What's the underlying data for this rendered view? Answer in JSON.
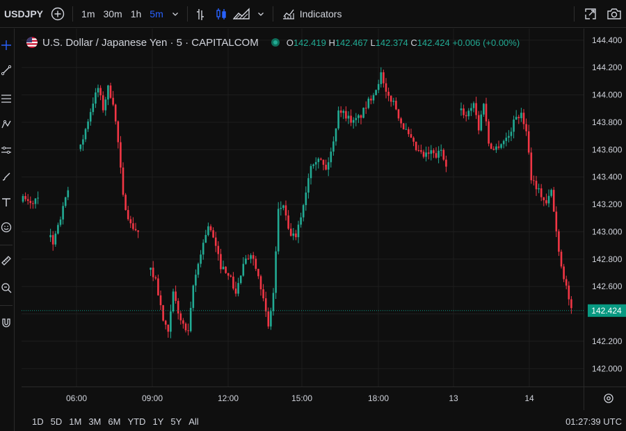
{
  "toolbar": {
    "symbol": "USDJPY",
    "intervals": [
      "1m",
      "30m",
      "1h",
      "5m"
    ],
    "active_interval": "5m",
    "indicators_label": "Indicators"
  },
  "legend": {
    "title": "U.S. Dollar / Japanese Yen · 5 · CAPITALCOM",
    "o_label": "O",
    "o_value": "142.419",
    "h_label": "H",
    "h_value": "142.467",
    "l_label": "L",
    "l_value": "142.374",
    "c_label": "C",
    "c_value": "142.424",
    "change": "+0.006 (+0.00%)"
  },
  "bottom": {
    "ranges": [
      "1D",
      "5D",
      "1M",
      "3M",
      "6M",
      "YTD",
      "1Y",
      "5Y",
      "All"
    ],
    "clock": "01:27:39 UTC"
  },
  "colors": {
    "up": "#22ab94",
    "down": "#f23645",
    "background": "#0f0f0f",
    "grid": "#1e1e1e",
    "accent": "#2962ff",
    "price_tag": "#089981"
  },
  "icons": [
    "plus-circle-icon",
    "chevron-down-icon",
    "bar-chart-icon",
    "candles-icon",
    "area-chart-icon",
    "indicators-icon",
    "fullscreen-icon",
    "camera-icon",
    "settings-icon"
  ],
  "chart_data": {
    "type": "candlestick",
    "symbol": "USDJPY",
    "interval": "5",
    "y_ticks": [
      "144.400",
      "144.200",
      "144.000",
      "143.800",
      "143.600",
      "143.400",
      "143.200",
      "143.000",
      "142.800",
      "142.600",
      "142.400",
      "142.200",
      "142.000"
    ],
    "ylim": [
      141.92,
      144.46
    ],
    "x_ticks": [
      "06:00",
      "09:00",
      "12:00",
      "15:00",
      "18:00",
      "13",
      "14"
    ],
    "last_price": "142.424",
    "path": [
      [
        0,
        143.24
      ],
      [
        3,
        143.2
      ],
      [
        6,
        143.25
      ],
      [
        10,
        143.05
      ],
      [
        12,
        142.9
      ],
      [
        15,
        143.1
      ],
      [
        18,
        143.3
      ],
      [
        22,
        143.55
      ],
      [
        25,
        143.75
      ],
      [
        28,
        143.95
      ],
      [
        30,
        144.05
      ],
      [
        32,
        143.9
      ],
      [
        34,
        144.05
      ],
      [
        36,
        143.95
      ],
      [
        38,
        143.65
      ],
      [
        40,
        143.25
      ],
      [
        43,
        143.05
      ],
      [
        46,
        143.0
      ],
      [
        50,
        142.75
      ],
      [
        53,
        142.65
      ],
      [
        56,
        142.35
      ],
      [
        58,
        142.25
      ],
      [
        60,
        142.55
      ],
      [
        63,
        142.35
      ],
      [
        66,
        142.25
      ],
      [
        68,
        142.6
      ],
      [
        71,
        142.85
      ],
      [
        74,
        143.05
      ],
      [
        76,
        142.95
      ],
      [
        79,
        142.75
      ],
      [
        82,
        142.7
      ],
      [
        85,
        142.55
      ],
      [
        88,
        142.75
      ],
      [
        91,
        142.85
      ],
      [
        94,
        142.7
      ],
      [
        96,
        142.5
      ],
      [
        98,
        142.3
      ],
      [
        100,
        142.55
      ],
      [
        102,
        143.15
      ],
      [
        104,
        143.2
      ],
      [
        106,
        143.0
      ],
      [
        109,
        142.95
      ],
      [
        112,
        143.2
      ],
      [
        115,
        143.5
      ],
      [
        118,
        143.55
      ],
      [
        121,
        143.45
      ],
      [
        124,
        143.65
      ],
      [
        126,
        143.9
      ],
      [
        129,
        143.85
      ],
      [
        132,
        143.8
      ],
      [
        135,
        143.85
      ],
      [
        138,
        143.95
      ],
      [
        141,
        144.05
      ],
      [
        143,
        144.15
      ],
      [
        145,
        144.0
      ],
      [
        148,
        143.95
      ],
      [
        151,
        143.8
      ],
      [
        154,
        143.7
      ],
      [
        157,
        143.6
      ],
      [
        160,
        143.55
      ],
      [
        163,
        143.58
      ],
      [
        165,
        143.55
      ],
      [
        167,
        143.6
      ],
      [
        169,
        143.5
      ],
      [
        174,
        143.9
      ],
      [
        177,
        143.85
      ],
      [
        180,
        143.95
      ],
      [
        182,
        143.75
      ],
      [
        184,
        143.95
      ],
      [
        186,
        143.65
      ],
      [
        188,
        143.6
      ],
      [
        191,
        143.65
      ],
      [
        194,
        143.7
      ],
      [
        197,
        143.85
      ],
      [
        199,
        143.85
      ],
      [
        201,
        143.75
      ],
      [
        203,
        143.4
      ],
      [
        206,
        143.3
      ],
      [
        209,
        143.2
      ],
      [
        211,
        143.3
      ],
      [
        213,
        143.0
      ],
      [
        215,
        142.75
      ],
      [
        217,
        142.6
      ],
      [
        219,
        142.42
      ]
    ]
  }
}
